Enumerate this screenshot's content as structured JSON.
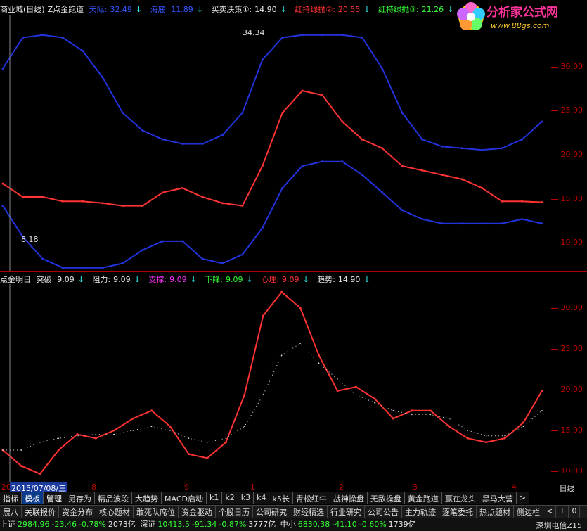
{
  "header": {
    "stock": "商业城(日线)",
    "indicator_name": "Z点金跑道",
    "items": [
      {
        "label": "天际:",
        "value": "32.49",
        "color": "blue"
      },
      {
        "label": "海底:",
        "value": "11.89",
        "color": "blue"
      },
      {
        "label": "买卖决策①:",
        "value": "14.90",
        "color": "white"
      },
      {
        "label": "红持绿抛②:",
        "value": "20.55",
        "color": "red"
      },
      {
        "label": "红持绿抛③:",
        "value": "21.26",
        "color": "green"
      }
    ]
  },
  "watermark": {
    "title": "分析家公式网",
    "url": "www.88gs.com"
  },
  "main_chart": {
    "high_label": "34.34",
    "low_label": "8.18",
    "yticks": [
      "30.00",
      "25.00",
      "20.00",
      "15.00",
      "10.00"
    ]
  },
  "sub_header": {
    "title": "点金明日",
    "items": [
      {
        "label": "突破:",
        "value": "9.09",
        "color": "white"
      },
      {
        "label": "阻力:",
        "value": "9.09",
        "color": "white"
      },
      {
        "label": "支撑:",
        "value": "9.09",
        "color": "magenta"
      },
      {
        "label": "下降:",
        "value": "9.09",
        "color": "green"
      },
      {
        "label": "心理:",
        "value": "9.09",
        "color": "red"
      },
      {
        "label": "趋势:",
        "value": "14.90",
        "color": "white"
      }
    ]
  },
  "sub_chart": {
    "yticks": [
      "30.00",
      "25.00",
      "20.00",
      "15.00",
      "10.00"
    ]
  },
  "date_axis": {
    "cursor_date": "2015/07/08/三",
    "labels": [
      "20",
      "8",
      "9",
      "1",
      "2",
      "3",
      "4"
    ],
    "period": "日线"
  },
  "tabs": {
    "items": [
      "指标",
      "模板",
      "管理",
      "另存为",
      "精品波段",
      "大趋势",
      "MACD启动",
      "k1",
      "k2",
      "k3",
      "k4",
      "k5长",
      "青松红牛",
      "战神操盘",
      "无敌操盘",
      "黄金跑道",
      "赢在龙头",
      "黑马大营"
    ],
    "active": "模板",
    "more": ">"
  },
  "bar2": {
    "items": [
      "展八",
      "关联报价",
      "资金分布",
      "核心题材",
      "敢死队席位",
      "资金驱动",
      "个股日历",
      "公司研究",
      "财经精选",
      "行业研究",
      "公司公告",
      "主力轨迹",
      "逐笔委托",
      "热点题材",
      "侧边栏"
    ],
    "extra": [
      "<",
      "+",
      "0"
    ]
  },
  "status": {
    "markets": [
      {
        "name": "上证",
        "index": "2984.96",
        "change": "-23.46",
        "pct": "-0.78%",
        "vol": "2073亿"
      },
      {
        "name": "深证",
        "index": "10413.5",
        "change": "-91.34",
        "pct": "-0.87%",
        "vol": "3777亿"
      },
      {
        "name": "中小",
        "index": "6830.38",
        "change": "-41.10",
        "pct": "-0.60%",
        "vol": "1739亿"
      }
    ],
    "broker": "深圳电信Z15"
  },
  "chart_data": [
    {
      "type": "line",
      "title": "Z点金跑道",
      "ylim": [
        7,
        36
      ],
      "series": [
        {
          "name": "天际",
          "values": [
            30,
            33.5,
            33.8,
            33.5,
            32,
            29,
            25,
            23,
            22,
            21.5,
            21.5,
            22.5,
            25,
            31,
            33.5,
            33.8,
            33.8,
            33.8,
            33.5,
            30,
            25,
            22,
            21.2,
            21,
            20.8,
            21,
            22,
            24
          ]
        },
        {
          "name": "海底",
          "values": [
            14.5,
            11,
            8.5,
            7.5,
            7.5,
            7.5,
            8,
            9.5,
            10.5,
            10.5,
            8.5,
            8,
            9,
            12,
            16.5,
            19,
            19.5,
            19.5,
            18,
            16,
            14,
            13,
            12.5,
            12.5,
            12.5,
            12.5,
            13,
            12.5
          ]
        },
        {
          "name": "买卖决策①",
          "values": [
            17,
            15.5,
            15.5,
            15,
            15,
            14.8,
            14.5,
            14.5,
            16,
            16.5,
            15.5,
            14.8,
            14.5,
            19,
            25,
            27.5,
            27,
            24,
            22,
            21,
            19,
            18.5,
            18,
            17.5,
            16.5,
            15,
            15,
            14.9
          ]
        }
      ]
    },
    {
      "type": "line",
      "title": "点金明日",
      "ylim": [
        9,
        34
      ],
      "series": [
        {
          "name": "趋势",
          "values": [
            13,
            11,
            10,
            13,
            15,
            14.5,
            15.5,
            17,
            18,
            16,
            12.5,
            12,
            14,
            20,
            30,
            33,
            31,
            25,
            20.5,
            21,
            19.5,
            17,
            18,
            18,
            16,
            14.5,
            14,
            14.5,
            16.5,
            20.5
          ]
        },
        {
          "name": "dots",
          "values": [
            13,
            13,
            14,
            14.5,
            14.8,
            15,
            15,
            15.5,
            16,
            15.5,
            14.5,
            14,
            14.5,
            16,
            20,
            25,
            26.5,
            24,
            22,
            20,
            19,
            18,
            17.5,
            17.5,
            17,
            15.5,
            14.8,
            14.8,
            16,
            18
          ]
        }
      ]
    }
  ]
}
